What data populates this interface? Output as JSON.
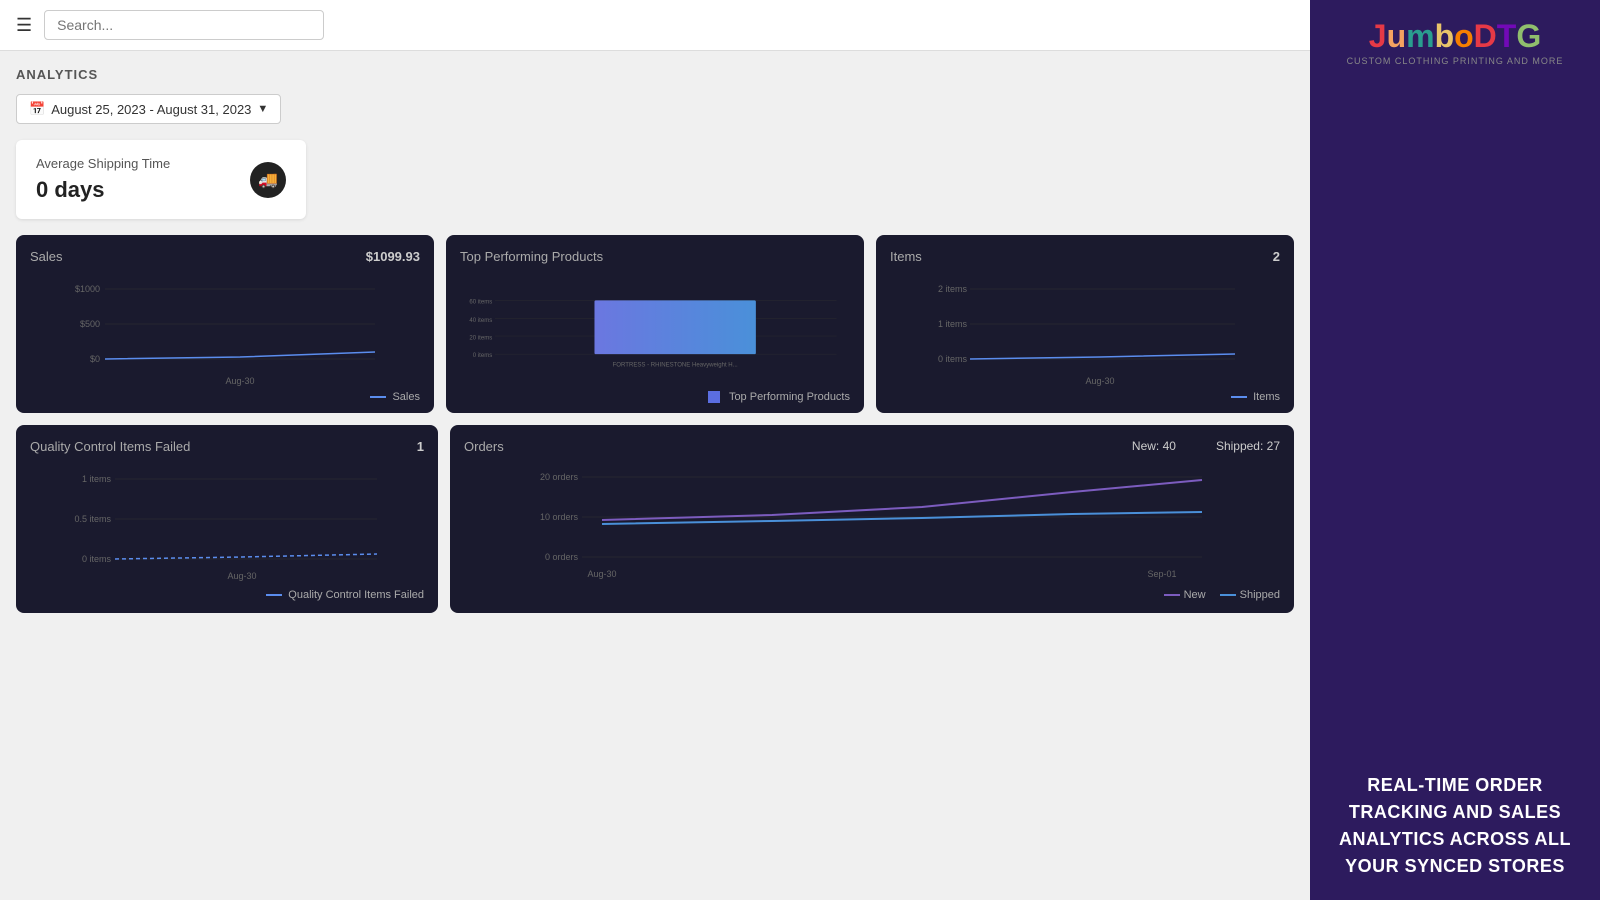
{
  "header": {
    "search_placeholder": "Search..."
  },
  "analytics": {
    "title": "ANALYTICS",
    "date_range": "August 25, 2023 - August 31, 2023"
  },
  "shipping": {
    "label": "Average Shipping Time",
    "value": "0 days"
  },
  "sales_card": {
    "title": "Sales",
    "value": "$1099.93",
    "legend": "Sales",
    "x_label": "Aug-30",
    "y_labels": [
      "$1000",
      "$500",
      "$0"
    ]
  },
  "top_products_card": {
    "title": "Top Performing Products",
    "x_label": "FORTRESS - RHINESTONE Heavyweight H...",
    "y_labels": [
      "60 items",
      "40 items",
      "20 items",
      "0 items"
    ],
    "legend": "Top Performing Products"
  },
  "items_card": {
    "title": "Items",
    "value": "2",
    "x_label": "Aug-30",
    "y_labels": [
      "2 items",
      "1 items",
      "0 items"
    ],
    "legend": "Items"
  },
  "qc_card": {
    "title": "Quality Control Items Failed",
    "value": "1",
    "x_label": "Aug-30",
    "y_labels": [
      "1 items",
      "0.5 items",
      "0 items"
    ],
    "legend": "Quality Control Items Failed"
  },
  "orders_card": {
    "title": "Orders",
    "new_label": "New: 40",
    "shipped_label": "Shipped: 27",
    "x_start": "Aug-30",
    "x_end": "Sep-01",
    "y_labels": [
      "20 orders",
      "10 orders",
      "0 orders"
    ],
    "legend_new": "New",
    "legend_shipped": "Shipped"
  },
  "sidebar": {
    "logo_line1": "JumboDTG",
    "logo_subtitle": "CUSTOM CLOTHING PRINTING AND MORE",
    "tagline": "REAL-TIME ORDER TRACKING AND SALES ANALYTICS ACROSS ALL YOUR SYNCED STORES"
  }
}
